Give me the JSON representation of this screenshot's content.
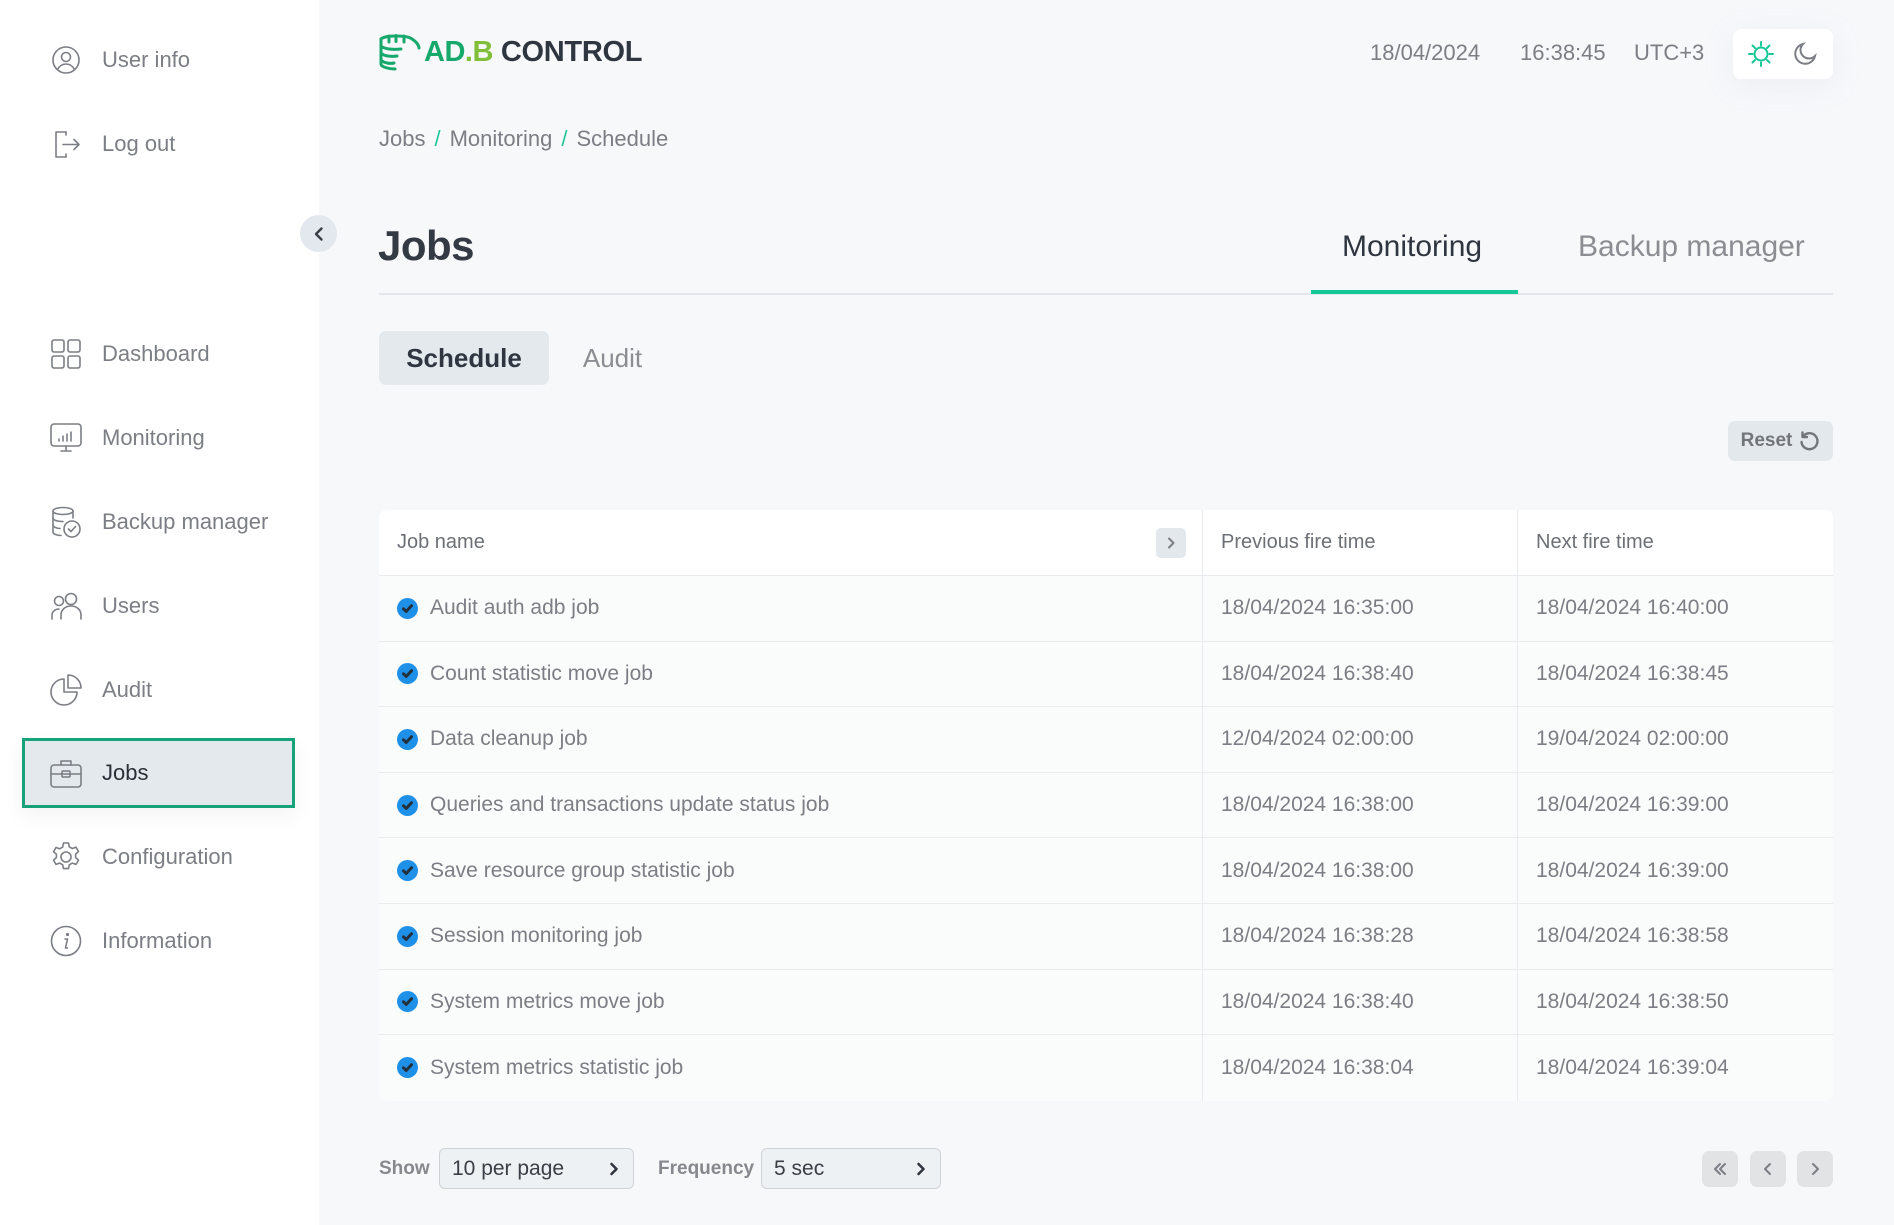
{
  "sidebar": {
    "user_items": [
      {
        "label": "User info",
        "icon": "user-circle-icon"
      },
      {
        "label": "Log out",
        "icon": "logout-icon"
      }
    ],
    "nav_items": [
      {
        "label": "Dashboard",
        "icon": "dashboard-grid-icon",
        "active": false
      },
      {
        "label": "Monitoring",
        "icon": "monitor-chart-icon",
        "active": false
      },
      {
        "label": "Backup manager",
        "icon": "database-backup-icon",
        "active": false
      },
      {
        "label": "Users",
        "icon": "users-icon",
        "active": false
      },
      {
        "label": "Audit",
        "icon": "pie-chart-icon",
        "active": false
      },
      {
        "label": "Jobs",
        "icon": "briefcase-icon",
        "active": true
      },
      {
        "label": "Configuration",
        "icon": "gear-icon",
        "active": false
      },
      {
        "label": "Information",
        "icon": "info-icon",
        "active": false
      }
    ],
    "collapse_icon": "chevron-left-icon"
  },
  "header": {
    "logo": {
      "part1": "AD",
      "part2": ".B",
      "part3": "CONTROL"
    },
    "date": "18/04/2024",
    "time": "16:38:45",
    "timezone": "UTC+3",
    "theme": {
      "light_icon": "sun-icon",
      "dark_icon": "moon-icon",
      "selected": "light"
    }
  },
  "breadcrumb": [
    "Jobs",
    "Monitoring",
    "Schedule"
  ],
  "breadcrumb_separator": "/",
  "page_title": "Jobs",
  "top_tabs": [
    {
      "label": "Monitoring",
      "active": true
    },
    {
      "label": "Backup manager",
      "active": false
    }
  ],
  "sub_tabs": [
    {
      "label": "Schedule",
      "active": true
    },
    {
      "label": "Audit",
      "active": false
    }
  ],
  "reset_button": {
    "label": "Reset",
    "icon": "refresh-icon"
  },
  "table": {
    "columns": [
      "Job name",
      "Previous fire time",
      "Next fire time"
    ],
    "rows": [
      {
        "name": "Audit auth adb job",
        "previous": "18/04/2024 16:35:00",
        "next": "18/04/2024 16:40:00",
        "enabled": true
      },
      {
        "name": "Count statistic move job",
        "previous": "18/04/2024 16:38:40",
        "next": "18/04/2024 16:38:45",
        "enabled": true
      },
      {
        "name": "Data cleanup job",
        "previous": "12/04/2024 02:00:00",
        "next": "19/04/2024 02:00:00",
        "enabled": true
      },
      {
        "name": "Queries and transactions update status job",
        "previous": "18/04/2024 16:38:00",
        "next": "18/04/2024 16:39:00",
        "enabled": true
      },
      {
        "name": "Save resource group statistic job",
        "previous": "18/04/2024 16:38:00",
        "next": "18/04/2024 16:39:00",
        "enabled": true
      },
      {
        "name": "Session monitoring job",
        "previous": "18/04/2024 16:38:28",
        "next": "18/04/2024 16:38:58",
        "enabled": true
      },
      {
        "name": "System metrics move job",
        "previous": "18/04/2024 16:38:40",
        "next": "18/04/2024 16:38:50",
        "enabled": true
      },
      {
        "name": "System metrics statistic job",
        "previous": "18/04/2024 16:38:04",
        "next": "18/04/2024 16:39:04",
        "enabled": true
      }
    ]
  },
  "footer": {
    "show_label": "Show",
    "show_value": "10 per page",
    "frequency_label": "Frequency",
    "frequency_value": "5 sec",
    "pagination": {
      "first_icon": "chevrons-left-icon",
      "prev_icon": "chevron-left-icon",
      "next_icon": "chevron-right-icon"
    }
  },
  "colors": {
    "accent": "#15c697",
    "active_border": "#17a27a",
    "status_check": "#1e90e8",
    "logo_green": "#17a86c",
    "logo_light_green": "#7fbf3a"
  }
}
